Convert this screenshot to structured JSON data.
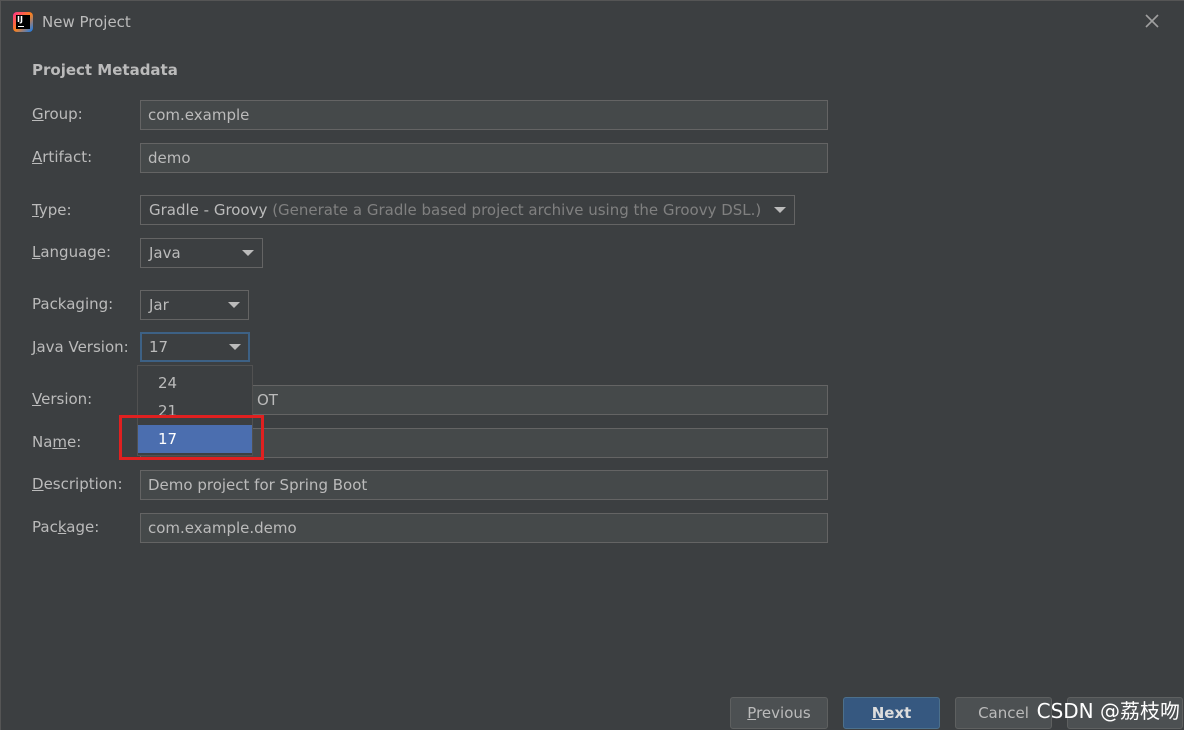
{
  "window": {
    "title": "New Project",
    "app_icon_text": "IJ"
  },
  "section": {
    "title": "Project Metadata"
  },
  "form": {
    "group": {
      "label": "Group:",
      "mnemonic": "G",
      "rest": "roup:",
      "value": "com.example"
    },
    "artifact": {
      "label": "Artifact:",
      "mnemonic": "A",
      "rest": "rtifact:",
      "value": "demo"
    },
    "type": {
      "label": "Type:",
      "mnemonic": "T",
      "rest": "ype:",
      "value": "Gradle - Groovy",
      "hint": "(Generate a Gradle based project archive using the Groovy DSL.)"
    },
    "language": {
      "label": "Language:",
      "pre": "",
      "mnemonic": "L",
      "rest": "anguage:",
      "value": "Java"
    },
    "packaging": {
      "label": "Packaging:",
      "value": "Jar"
    },
    "java_version": {
      "label": "Java Version:",
      "mnemonic": "J",
      "rest": "ava Version:",
      "value": "17"
    },
    "version": {
      "label": "Version:",
      "mnemonic": "V",
      "rest": "ersion:",
      "value": "OT"
    },
    "name": {
      "label": "Name:",
      "pre": "Na",
      "mnemonic": "m",
      "rest": "e:",
      "value": ""
    },
    "description": {
      "label": "Description:",
      "mnemonic": "D",
      "rest": "escription:",
      "value": "Demo project for Spring Boot"
    },
    "package": {
      "label": "Package:",
      "pre": "Pac",
      "mnemonic": "k",
      "rest": "age:",
      "value": "com.example.demo"
    }
  },
  "java_version_dropdown": {
    "options": [
      "24",
      "21",
      "17"
    ],
    "selected": "17"
  },
  "buttons": {
    "previous": {
      "mnemonic": "P",
      "rest": "revious"
    },
    "next": {
      "mnemonic": "N",
      "rest": "ext"
    },
    "cancel": {
      "label": "Cancel"
    }
  },
  "watermark": "CSDN @荔枝吻",
  "colors": {
    "background": "#3c3f41",
    "field_bg": "#45494a",
    "selection": "#4b6eaf",
    "default_button": "#365880",
    "highlight": "#e02020",
    "focus_border": "#3d6185"
  }
}
